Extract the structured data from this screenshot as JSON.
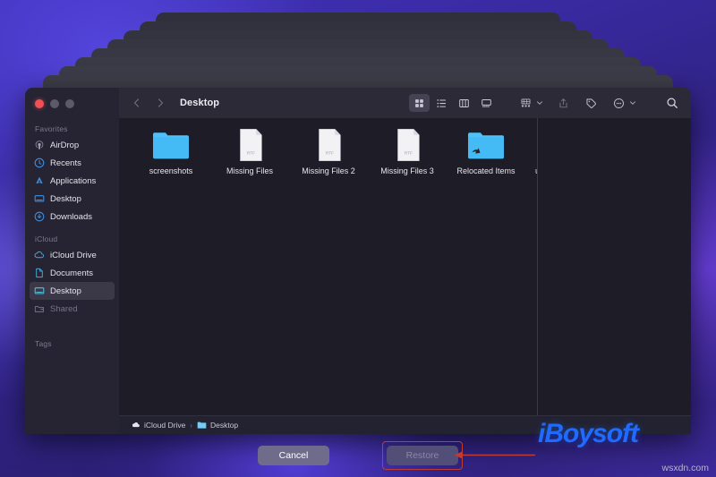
{
  "window": {
    "traffic_lights": [
      "close",
      "minimize",
      "maximize"
    ],
    "title": "Desktop"
  },
  "sidebar": {
    "sections": [
      {
        "label": "Favorites",
        "items": [
          {
            "label": "AirDrop",
            "icon": "airdrop-icon",
            "selected": false,
            "dim": false
          },
          {
            "label": "Recents",
            "icon": "recents-clock-icon",
            "selected": false,
            "dim": false
          },
          {
            "label": "Applications",
            "icon": "applications-icon",
            "selected": false,
            "dim": false
          },
          {
            "label": "Desktop",
            "icon": "desktop-monitor-icon",
            "selected": false,
            "dim": false
          },
          {
            "label": "Downloads",
            "icon": "downloads-arrow-icon",
            "selected": false,
            "dim": false
          }
        ]
      },
      {
        "label": "iCloud",
        "items": [
          {
            "label": "iCloud Drive",
            "icon": "cloud-icon",
            "selected": false,
            "dim": false
          },
          {
            "label": "Documents",
            "icon": "document-page-icon",
            "selected": false,
            "dim": false
          },
          {
            "label": "Desktop",
            "icon": "desktop-monitor-icon",
            "selected": true,
            "dim": false
          },
          {
            "label": "Shared",
            "icon": "shared-folder-icon",
            "selected": false,
            "dim": true
          }
        ]
      },
      {
        "label": "Tags",
        "items": []
      }
    ]
  },
  "toolbar": {
    "back_icon": "chevron-left-icon",
    "forward_icon": "chevron-right-icon",
    "title": "Desktop",
    "view_modes": [
      {
        "name": "icon-view",
        "icon": "grid-view-icon",
        "active": true
      },
      {
        "name": "list-view",
        "icon": "list-view-icon",
        "active": false
      },
      {
        "name": "column-view",
        "icon": "column-view-icon",
        "active": false
      },
      {
        "name": "gallery-view",
        "icon": "gallery-view-icon",
        "active": false
      }
    ],
    "actions": [
      {
        "name": "group-by",
        "icon": "group-by-icon",
        "chevron": true,
        "disabled": false
      },
      {
        "name": "share",
        "icon": "share-upload-icon",
        "chevron": false,
        "disabled": true
      },
      {
        "name": "tags",
        "icon": "tag-icon",
        "chevron": false,
        "disabled": false
      },
      {
        "name": "more-actions",
        "icon": "more-circle-icon",
        "chevron": true,
        "disabled": false
      }
    ],
    "search_icon": "search-icon"
  },
  "files": [
    {
      "name": "screenshots",
      "kind": "folder",
      "alias": false
    },
    {
      "name": "Missing Files",
      "kind": "rtf-document",
      "alias": false,
      "badge": "RTF"
    },
    {
      "name": "Missing Files 2",
      "kind": "rtf-document",
      "alias": false,
      "badge": "RTF"
    },
    {
      "name": "Missing Files 3",
      "kind": "rtf-document",
      "alias": false,
      "badge": "RTF"
    },
    {
      "name": "Relocated Items",
      "kind": "folder",
      "alias": true
    },
    {
      "name": "ur",
      "kind": "clipped",
      "alias": false
    }
  ],
  "pathbar": {
    "crumbs": [
      {
        "label": "iCloud Drive",
        "icon": "cloud-icon"
      },
      {
        "label": "Desktop",
        "icon": "folder-icon"
      }
    ],
    "separator": "›"
  },
  "actions": {
    "cancel_label": "Cancel",
    "restore_label": "Restore",
    "restore_disabled": true
  },
  "annotation": {
    "highlight_color": "#c03b32",
    "arrow_color": "#c03b32",
    "target": "restore-button"
  },
  "watermarks": {
    "brand": "iBoysoft",
    "brand_color": "#1f6bff",
    "site": "wsxdn.com"
  }
}
